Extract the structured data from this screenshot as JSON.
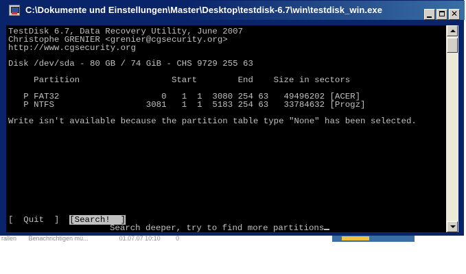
{
  "window": {
    "title": "C:\\Dokumente und Einstellungen\\Master\\Desktop\\testdisk-6.7\\win\\testdisk_win.exe",
    "minimize_label": "_",
    "maximize_label": "□",
    "close_label": "✕"
  },
  "console": {
    "header1": "TestDisk 6.7, Data Recovery Utility, June 2007",
    "header2": "Christophe GRENIER <grenier@cgsecurity.org>",
    "header3": "http://www.cgsecurity.org",
    "disk_info": "Disk /dev/sda - 80 GB / 74 GiB - CHS 9729 255 63",
    "table_header": "     Partition                  Start        End    Size in sectors",
    "rows": [
      "   P FAT32                    0   1  1  3080 254 63   49496202 [ACER]",
      "   P NTFS                  3081   1  1  5183 254 63   33784632 [Progz]"
    ],
    "message": "Write isn't available because the partition table type \"None\" has been selected.",
    "menu_quit": "[  Quit  ]",
    "menu_search": "[Search!  ]",
    "hint": "Search deeper, try to find more partitions"
  },
  "background": {
    "text": "rallen       Benachrichtigen mü...                  01.07.07 10:10         0"
  },
  "colors": {
    "titlebar": "#0a246a",
    "console_bg": "#000000",
    "console_fg": "#c0c0c0"
  }
}
